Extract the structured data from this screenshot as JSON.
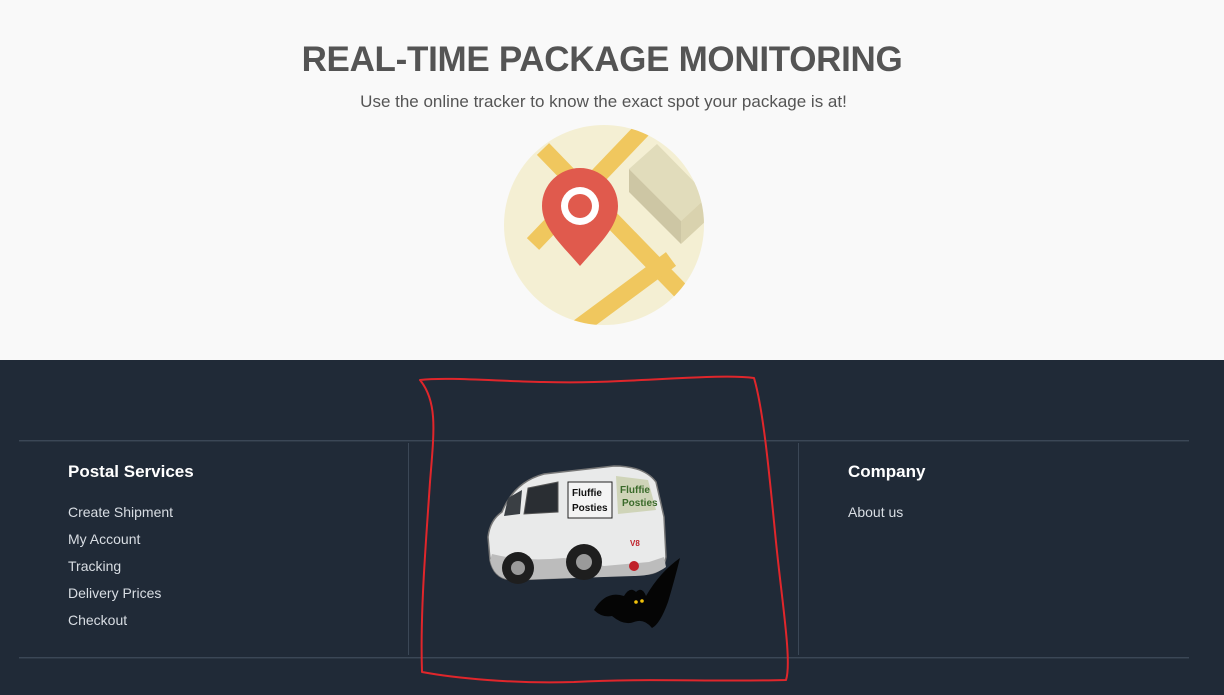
{
  "hero": {
    "title": "REAL-TIME PACKAGE MONITORING",
    "subtitle": "Use the online tracker to know the exact spot your package is at!",
    "illustration_icon": "map-location-pin-icon"
  },
  "footer": {
    "postal_services": {
      "title": "Postal Services",
      "links": [
        "Create Shipment",
        "My Account",
        "Tracking",
        "Delivery Prices",
        "Checkout"
      ]
    },
    "logo": {
      "van_text_1": "Fluffie Posties",
      "van_text_2": "Fluffie Posties",
      "van_plate": "V8",
      "icon": "van-and-bat-logo"
    },
    "company": {
      "title": "Company",
      "links": [
        "About us"
      ]
    }
  },
  "annotation": {
    "color": "#e0262b",
    "shape": "hand-drawn-box"
  },
  "colors": {
    "hero_bg": "#f9f9f9",
    "footer_bg": "#202a37",
    "map_circle": "#f4efd3",
    "road": "#f0c75e",
    "pin": "#e05a4d"
  }
}
